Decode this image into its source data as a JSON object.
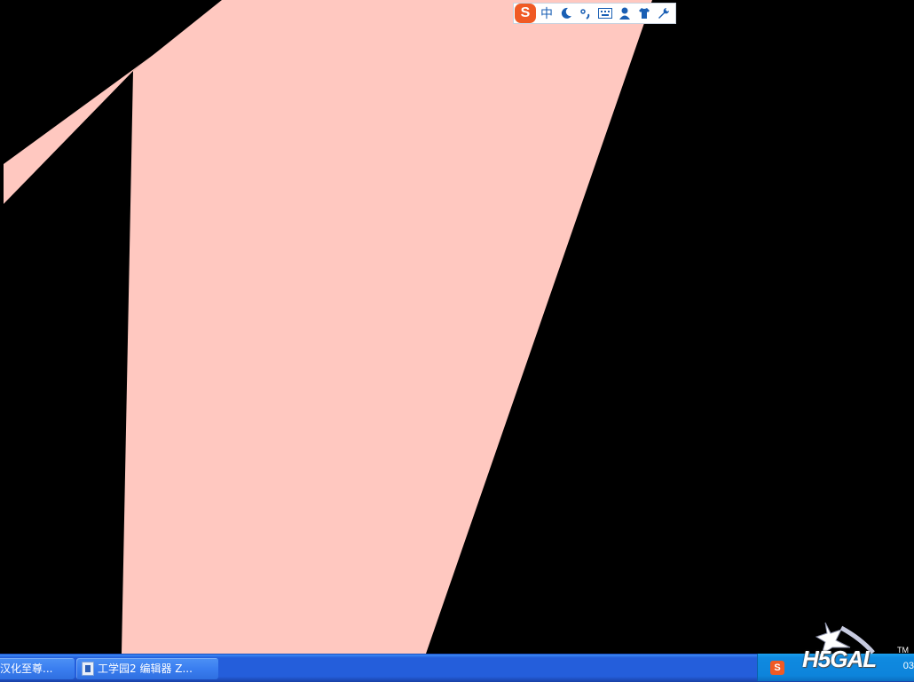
{
  "ime_toolbar": {
    "logo_letter": "S",
    "mode_label": "中",
    "buttons": [
      "moon-icon",
      "punctuation-icon",
      "keyboard-icon",
      "user-icon",
      "shirt-icon",
      "wrench-icon"
    ],
    "brand_color": "#f05a24",
    "icon_color": "#1a5fb4"
  },
  "canvas": {
    "background_color": "#000000",
    "shape_color": "#ffc8c0"
  },
  "taskbar": {
    "tasks": [
      {
        "label": "汉化至尊..."
      },
      {
        "label": "工学园2 编辑器 Z..."
      }
    ],
    "tray_ime_letter": "S",
    "clock_partial": "03"
  },
  "watermark": {
    "text": "H5GAL",
    "tm": "TM"
  }
}
